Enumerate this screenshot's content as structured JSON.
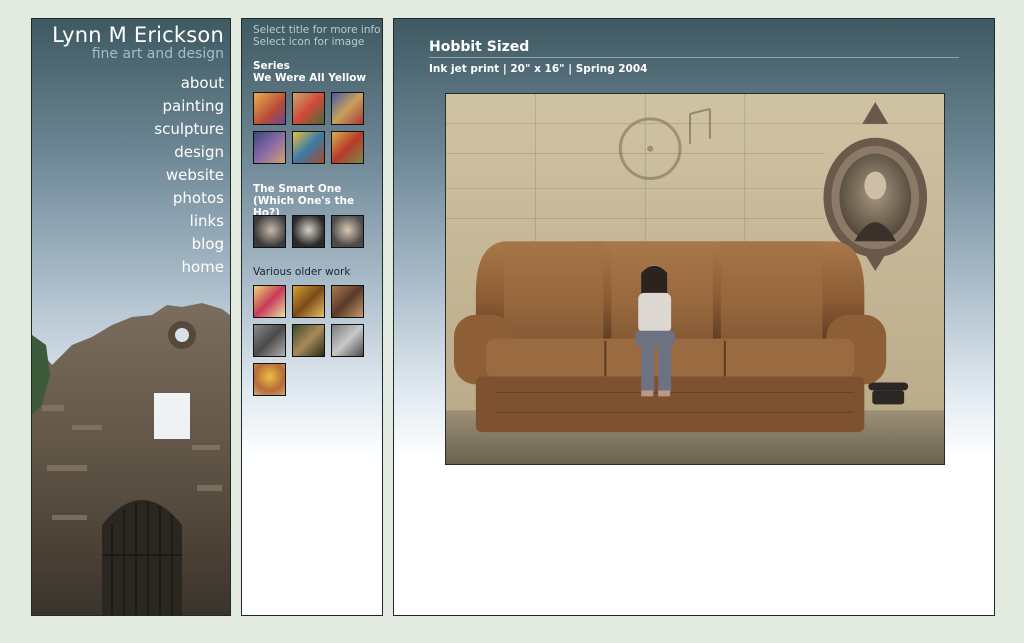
{
  "site": {
    "title": "Lynn M Erickson",
    "subtitle": "fine art and design"
  },
  "nav": {
    "items": [
      {
        "label": "about"
      },
      {
        "label": "painting"
      },
      {
        "label": "sculpture"
      },
      {
        "label": "design"
      },
      {
        "label": "website"
      },
      {
        "label": "photos"
      },
      {
        "label": "links"
      },
      {
        "label": "blog"
      },
      {
        "label": "home"
      }
    ]
  },
  "thumbs_panel": {
    "hint_line1": "Select title for more info",
    "hint_line2": "Select icon for image",
    "series": [
      {
        "title_line1": "Series",
        "title_line2": "We Were All Yellow",
        "count": 6
      },
      {
        "title_line1": "The Smart One",
        "title_line2": "(Which One's the Ho?)",
        "count": 3
      },
      {
        "title_line1": "Various older work",
        "title_line2": "",
        "count": 7
      }
    ]
  },
  "artwork": {
    "title": "Hobbit Sized",
    "meta": "Ink jet print | 20\" x 16\" | Spring 2004"
  },
  "colors": {
    "page_background": "#e3ebe1",
    "panel_top": "#3f5962",
    "panel_bottom": "#ffffff"
  }
}
